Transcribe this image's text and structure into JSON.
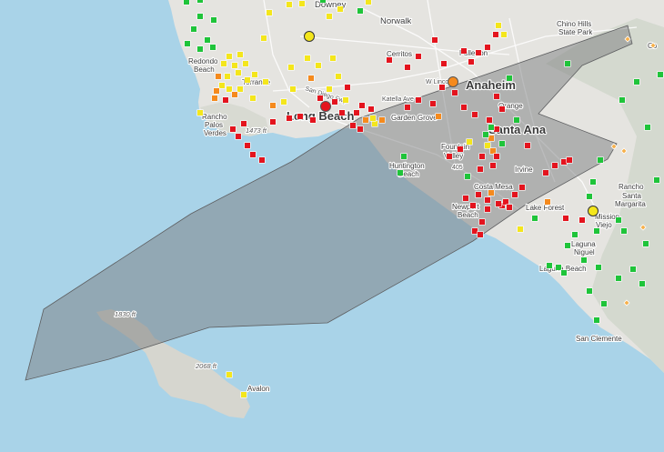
{
  "map": {
    "colors": {
      "water": "#a9d3e8",
      "land": "#e5e4e0",
      "terrain": "#d6dbd1",
      "smoke_fill": "#7c7d80",
      "sensor_good": "#1fc43a",
      "sensor_moderate": "#f4e61c",
      "sensor_usg": "#f58a1d",
      "sensor_unhealthy": "#e4141e"
    },
    "labels": {
      "downey": "Downey",
      "norwalk": "Norwalk",
      "chino_hills": "Chino Hills",
      "state_park": "State Park",
      "corona": "Co",
      "redondo": "Redondo",
      "redondo_beach": "Beach",
      "torrance": "Torrance",
      "cerritos": "Cerritos",
      "fullerton": "Fullerton",
      "anaheim": "Anaheim",
      "orange": "Orange",
      "long_beach": "Long Beach",
      "garden_grove": "Garden Grove",
      "santa_ana": "Santa Ana",
      "rancho": "Rancho",
      "palos": "Palos",
      "verdes": "Verdes",
      "fountain": "Fountain",
      "valley": "Valley",
      "huntington": "Huntington",
      "huntington_beach": "Beach",
      "irvine": "Irvine",
      "costa_mesa": "Costa Mesa",
      "newport": "Newport",
      "newport_beach": "Beach",
      "lake_forest": "Lake Forest",
      "rancho2": "Rancho",
      "santa": "Santa",
      "margarita": "Margarita",
      "mission": "Mission",
      "viejo": "Viejo",
      "laguna": "Laguna",
      "niguel": "Niguel",
      "laguna_beach": "Laguna Beach",
      "san_clemente": "San Clemente",
      "avalon": "Avalon",
      "elev_1473": "1473 ft",
      "elev_1830": "1830 ft",
      "elev_2068": "2068 ft",
      "road_san_diego": "San Diego Fwy",
      "road_katella": "Katella Ave",
      "road_lincoln": "W Lincoln",
      "road_405": "405"
    }
  }
}
